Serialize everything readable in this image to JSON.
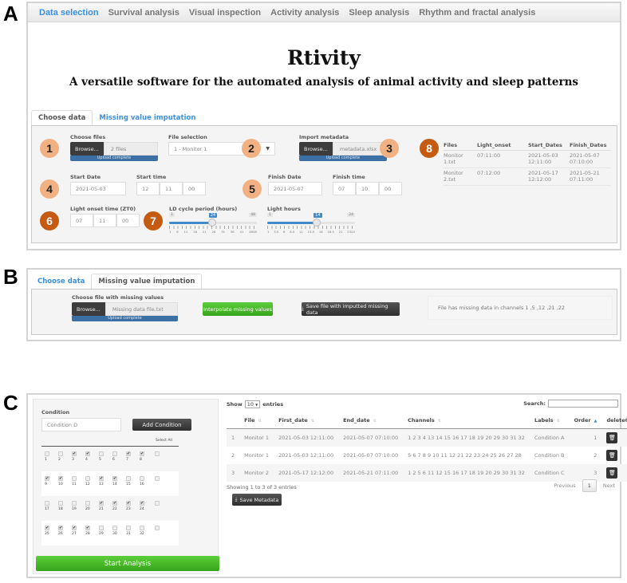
{
  "panel_letters": {
    "a": "A",
    "b": "B",
    "c": "C"
  },
  "navbar": {
    "items": [
      "Data selection",
      "Survival analysis",
      "Visual inspection",
      "Activity analysis",
      "Sleep analysis",
      "Rhythm and fractal analysis"
    ],
    "active": "Data selection"
  },
  "app": {
    "title": "Rtivity",
    "subtitle": "A versatile software for the automated analysis of animal activity and sleep patterns"
  },
  "tabs": {
    "choose": "Choose data",
    "imputation": "Missing value imputation"
  },
  "choose_data": {
    "choose_files": {
      "label": "Choose files",
      "browse": "Browse...",
      "value": "2 files",
      "status": "Upload complete"
    },
    "file_selection": {
      "label": "File selection",
      "value": "1 - Monitor 1"
    },
    "import_metadata": {
      "label": "Import metadata",
      "browse": "Browse...",
      "value": "metadata.xlsx",
      "status": "Upload complete"
    },
    "start_date": {
      "label": "Start Date",
      "value": "2021-05-03"
    },
    "start_time": {
      "label": "Start time",
      "h": "12",
      "m": "11",
      "s": "00"
    },
    "finish_date": {
      "label": "Finish Date",
      "value": "2021-05-07"
    },
    "finish_time": {
      "label": "Finish time",
      "h": "07",
      "m": "10",
      "s": "00"
    },
    "light_onset": {
      "label": "Light onset time (ZT0)",
      "h": "07",
      "m": "11",
      "s": "00"
    },
    "ld_cycle": {
      "label": "LD cycle period (hours)",
      "min": "1",
      "max": "48",
      "value": "24",
      "value_num": 24,
      "min_num": 1,
      "max_num": 48,
      "ticks": [
        "1",
        "6",
        "11",
        "16",
        "21",
        "26",
        "31",
        "36",
        "41",
        "4648"
      ]
    },
    "light_hours": {
      "label": "Light hours",
      "min": "1",
      "max": "24",
      "value": "14",
      "value_num": 14,
      "min_num": 1,
      "max_num": 24,
      "ticks": [
        "1",
        "3.5",
        "6",
        "8.5",
        "11",
        "13.5",
        "16",
        "18.5",
        "21",
        "2324"
      ]
    },
    "badges": [
      "1",
      "2",
      "3",
      "4",
      "5",
      "6",
      "7",
      "8"
    ],
    "files_table": {
      "headers": [
        "Files",
        "Light_onset",
        "Start_Dates",
        "Finish_Dates"
      ],
      "rows": [
        [
          "Monitor 1.txt",
          "07:11:00",
          "2021-05-03 12:11:00",
          "2021-05-07 07:10:00"
        ],
        [
          "Monitor 2.txt",
          "07:12:00",
          "2021-05-17 12:12:00",
          "2021-05-21 07:11:00"
        ]
      ]
    }
  },
  "imputation": {
    "label": "Choose file with missing values",
    "browse": "Browse...",
    "value": "Missing data file.txt",
    "status": "Upload complete",
    "interpolate_button": "Interpolate missing values",
    "save_button": "Save file with imputted missing data",
    "message": "File has missing data in channels 1 ,5 ,12 ,21 ,22"
  },
  "conditions": {
    "label": "Condition",
    "input_value": "Condition D",
    "add_button": "Add Condition",
    "select_all": "Select All",
    "channels": [
      {
        "n": "1",
        "c": false
      },
      {
        "n": "2",
        "c": false
      },
      {
        "n": "3",
        "c": true
      },
      {
        "n": "4",
        "c": true
      },
      {
        "n": "5",
        "c": false
      },
      {
        "n": "6",
        "c": false
      },
      {
        "n": "7",
        "c": true
      },
      {
        "n": "8",
        "c": true
      },
      {
        "n": "9",
        "c": true
      },
      {
        "n": "10",
        "c": true
      },
      {
        "n": "11",
        "c": false
      },
      {
        "n": "12",
        "c": false
      },
      {
        "n": "13",
        "c": true
      },
      {
        "n": "14",
        "c": true
      },
      {
        "n": "15",
        "c": false
      },
      {
        "n": "16",
        "c": false
      },
      {
        "n": "17",
        "c": false
      },
      {
        "n": "18",
        "c": false
      },
      {
        "n": "19",
        "c": false
      },
      {
        "n": "20",
        "c": false
      },
      {
        "n": "21",
        "c": true
      },
      {
        "n": "22",
        "c": true
      },
      {
        "n": "23",
        "c": true
      },
      {
        "n": "24",
        "c": true
      },
      {
        "n": "25",
        "c": true
      },
      {
        "n": "26",
        "c": true
      },
      {
        "n": "27",
        "c": true
      },
      {
        "n": "28",
        "c": true
      },
      {
        "n": "29",
        "c": false
      },
      {
        "n": "30",
        "c": false
      },
      {
        "n": "31",
        "c": false
      },
      {
        "n": "32",
        "c": false
      }
    ],
    "start_button": "Start Analysis"
  },
  "metadata_table": {
    "show_prefix": "Show",
    "page_length": "10",
    "show_suffix": "entries",
    "search_label": "Search:",
    "search_value": "",
    "headers": [
      "",
      "File",
      "First_date",
      "End_date",
      "Channels",
      "Labels",
      "Order",
      "deleteCol"
    ],
    "rows": [
      [
        "1",
        "Monitor 1",
        "2021-05-03 12:11:00",
        "2021-05-07 07:10:00",
        "1 2 3 4 13 14 15 16 17 18 19 20 29 30 31 32",
        "Condition A",
        "1"
      ],
      [
        "2",
        "Monitor 1",
        "2021-05-03 12:11:00",
        "2021-05-07 07:10:00",
        "5 6 7 8 9 10 11 12 21 22 23 24 25 26 27 28",
        "Condition B",
        "2"
      ],
      [
        "3",
        "Monitor 2",
        "2021-05-17 12:12:00",
        "2021-05-21 07:11:00",
        "1 2 5 6 11 12 15 16 17 18 19 20 29 30 31 32",
        "Condition C",
        "3"
      ]
    ],
    "info": "Showing 1 to 3 of 3 entries",
    "prev": "Previous",
    "page": "1",
    "next": "Next",
    "save_button": "Save Metadata"
  },
  "colors": {
    "accent": "#3b8fde",
    "badge_light": "#f2b183",
    "badge_dark": "#c55a11",
    "green": "#3cb521",
    "upload_bar": "#3c6fa3"
  }
}
